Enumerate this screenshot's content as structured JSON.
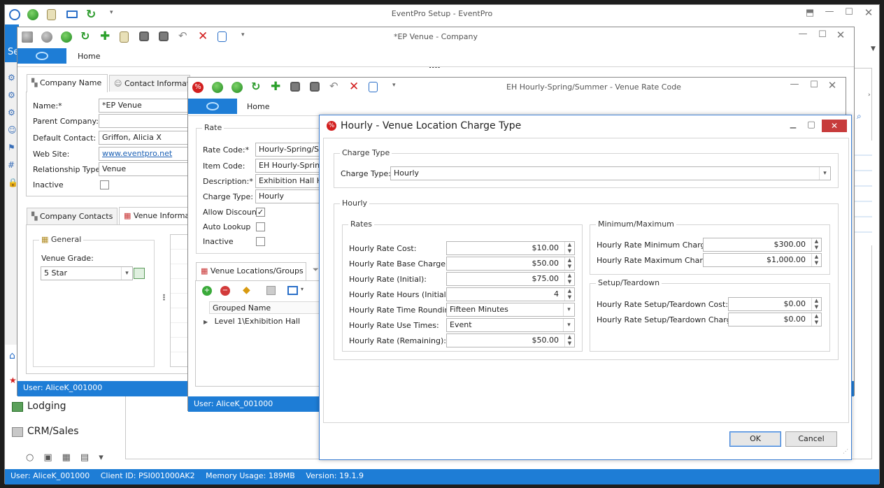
{
  "main_window": {
    "title": "EventPro Setup - EventPro",
    "status": {
      "user": "User: AliceK_001000",
      "client": "Client ID: PSI001000AK2",
      "memory": "Memory Usage: 189MB",
      "version": "Version: 19.1.9"
    },
    "nav": {
      "lodging": "Lodging",
      "crm": "CRM/Sales",
      "se": "Se"
    }
  },
  "company_window": {
    "title": "*EP Venue - Company",
    "home_label": "Home",
    "ellipsis": "....",
    "tabs": [
      "Company Name",
      "Contact Informatio"
    ],
    "fields": {
      "name_label": "Name:*",
      "name_value": "*EP Venue",
      "parent_label": "Parent Company:",
      "parent_value": "",
      "contact_label": "Default Contact:",
      "contact_value": "Griffon, Alicia X",
      "web_label": "Web Site:",
      "web_value": "www.eventpro.net",
      "rel_label": "Relationship Type:",
      "rel_value": "Venue",
      "inactive_label": "Inactive"
    },
    "lower_tabs": [
      "Company Contacts",
      "Venue Informa"
    ],
    "general": {
      "title": "General",
      "grade_label": "Venue Grade:",
      "grade_value": "5 Star"
    },
    "status": "User: AliceK_001000"
  },
  "rate_window": {
    "title": "EH Hourly-Spring/Summer - Venue Rate Code",
    "home_label": "Home",
    "group_title": "Rate",
    "fields": {
      "rate_code_label": "Rate Code:*",
      "rate_code_value": "Hourly-Spring/Sum",
      "item_code_label": "Item Code:",
      "item_code_value": "EH Hourly-Spring/S",
      "desc_label": "Description:*",
      "desc_value": "Exhibition Hall Hou",
      "charge_label": "Charge Type:",
      "charge_value": "Hourly",
      "allow_label": "Allow Discount",
      "auto_label": "Auto Lookup",
      "inactive_label": "Inactive"
    },
    "locations_tab": "Venue Locations/Groups",
    "grid_header": "Grouped Name",
    "grid_row": "Level 1\\Exhibition Hall",
    "status": "User: AliceK_001000"
  },
  "dialog": {
    "title": "Hourly - Venue Location Charge Type",
    "charge_group": "Charge Type",
    "charge_label": "Charge Type:",
    "charge_value": "Hourly",
    "hourly_group": "Hourly",
    "rates_group": "Rates",
    "rates": [
      {
        "label": "Hourly Rate Cost:",
        "value": "$10.00",
        "kind": "spin"
      },
      {
        "label": "Hourly Rate Base Charge:",
        "value": "$50.00",
        "kind": "spin"
      },
      {
        "label": "Hourly Rate (Initial):",
        "value": "$75.00",
        "kind": "spin"
      },
      {
        "label": "Hourly Rate Hours (Initial):",
        "value": "4",
        "kind": "spin"
      },
      {
        "label": "Hourly Rate Time Rounding:",
        "value": "Fifteen Minutes",
        "kind": "dropdown"
      },
      {
        "label": "Hourly Rate Use Times:",
        "value": "Event",
        "kind": "dropdown"
      },
      {
        "label": "Hourly Rate (Remaining):",
        "value": "$50.00",
        "kind": "spin"
      }
    ],
    "minmax_group": "Minimum/Maximum",
    "minmax": [
      {
        "label": "Hourly Rate Minimum Charge:",
        "value": "$300.00"
      },
      {
        "label": "Hourly Rate Maximum Charge:",
        "value": "$1,000.00"
      }
    ],
    "setup_group": "Setup/Teardown",
    "setup": [
      {
        "label": "Hourly Rate Setup/Teardown Cost:",
        "value": "$0.00"
      },
      {
        "label": "Hourly Rate Setup/Teardown Charge:",
        "value": "$0.00"
      }
    ],
    "ok_label": "OK",
    "cancel_label": "Cancel"
  }
}
